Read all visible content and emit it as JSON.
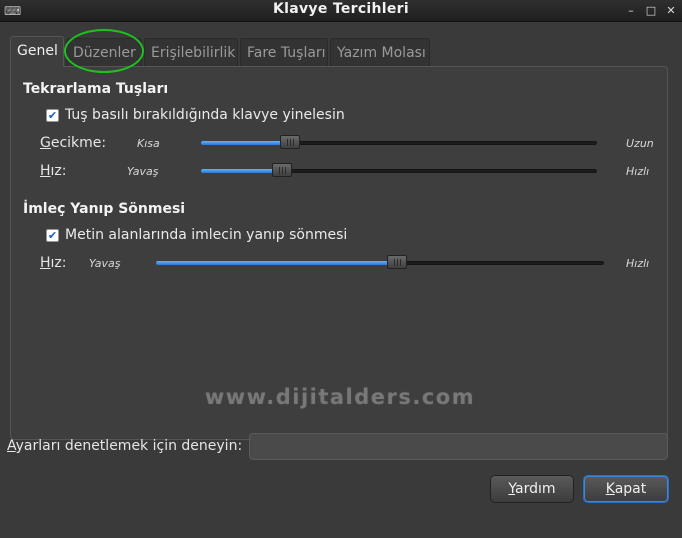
{
  "window": {
    "title": "Klavye Tercihleri",
    "controls": {
      "minimize": "–",
      "maximize": "□",
      "close": "✕"
    }
  },
  "tabs": [
    {
      "label": "Genel",
      "active": true
    },
    {
      "label": "Düzenler",
      "active": false
    },
    {
      "label": "Erişilebilirlik",
      "active": false
    },
    {
      "label": "Fare Tuşları",
      "active": false
    },
    {
      "label": "Yazım Molası",
      "active": false
    }
  ],
  "repeat_section": {
    "title": "Tekrarlama Tuşları",
    "checkbox": {
      "label_pre": "Tuş ",
      "label_u": "b",
      "label_post": "asılı bırakıldığında klavye yinelesin",
      "checked": true
    },
    "delay": {
      "label_u": "G",
      "label_rest": "ecikme:",
      "min_label": "Kısa",
      "max_label": "Uzun",
      "value_fraction": 0.21
    },
    "speed": {
      "label_u": "H",
      "label_rest": "ız:",
      "min_label": "Yavaş",
      "max_label": "Hızlı",
      "value_fraction": 0.19
    }
  },
  "cursor_section": {
    "title": "İmleç Yanıp Sönmesi",
    "checkbox": {
      "label_u": "M",
      "label_post": "etin alanlarında imlecin yanıp sönmesi",
      "checked": true
    },
    "speed": {
      "label_u": "H",
      "label_rest": "ız:",
      "min_label": "Yavaş",
      "max_label": "Hızlı",
      "value_fraction": 0.54
    }
  },
  "watermark": "www.dijitalders.com",
  "test": {
    "label_u": "A",
    "label_rest": "yarları denetlemek için deneyin:",
    "value": "",
    "placeholder": ""
  },
  "buttons": {
    "help": {
      "label_u": "Y",
      "label_rest": "ardım"
    },
    "close": {
      "label_u": "K",
      "label_rest": "apat"
    }
  },
  "colors": {
    "accent": "#2a78d6",
    "highlight_ring": "#1ec21e"
  }
}
